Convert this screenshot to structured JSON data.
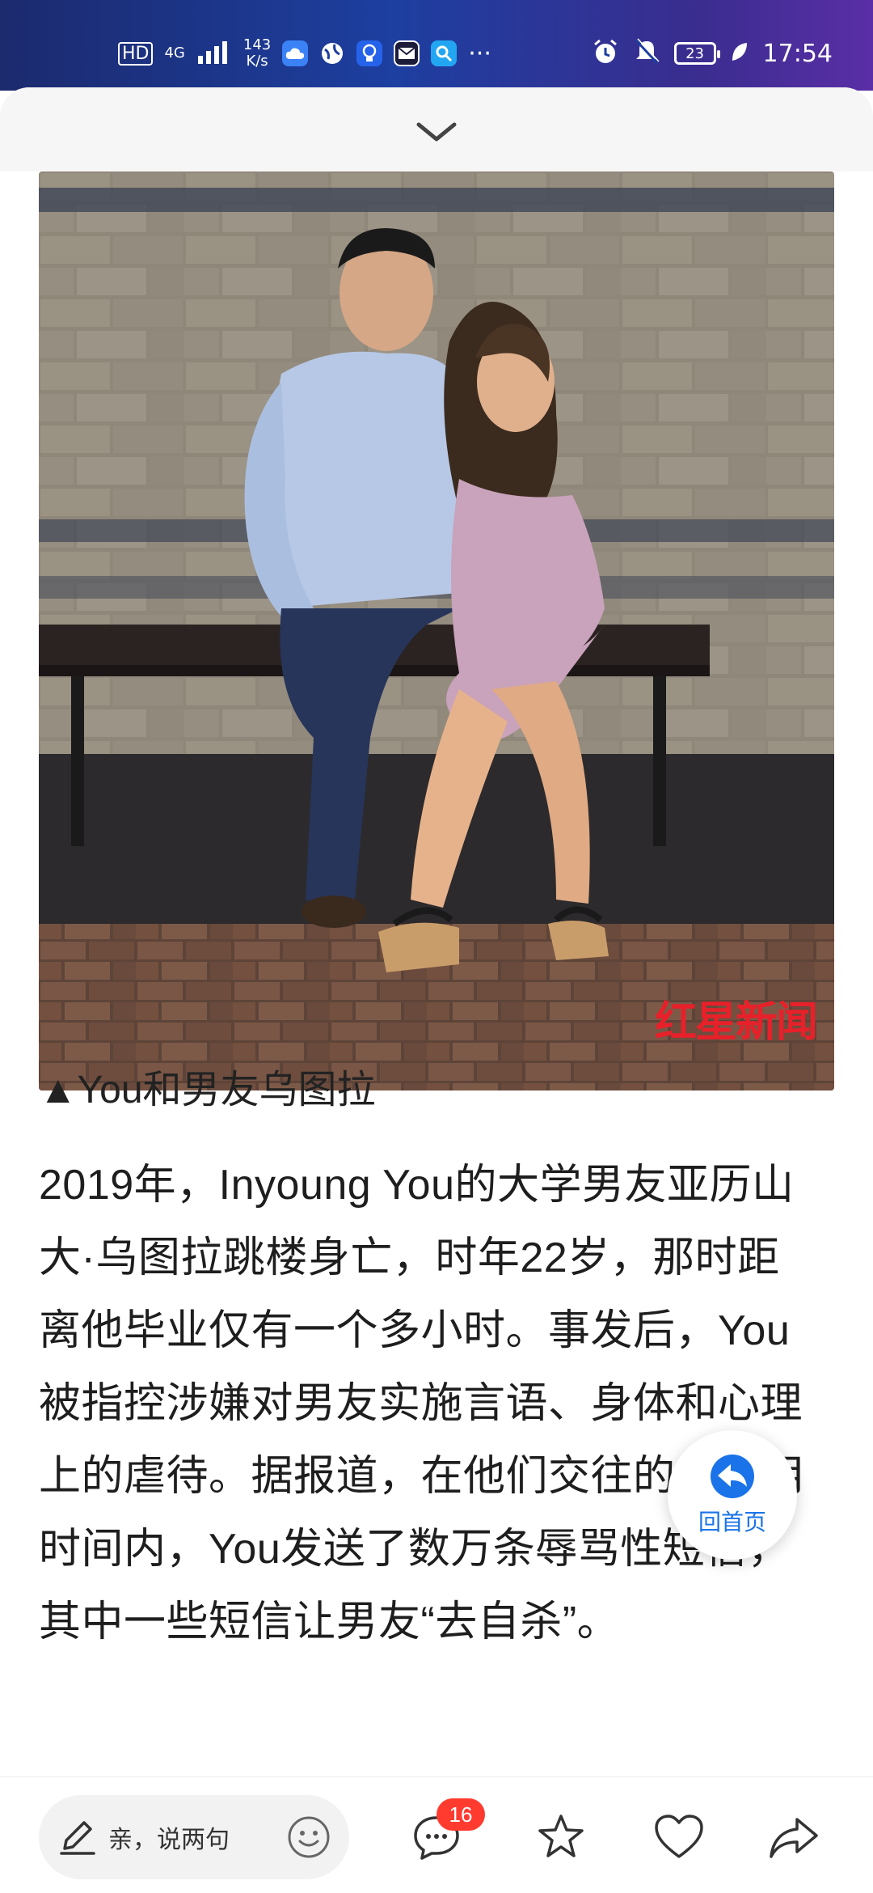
{
  "status_bar": {
    "hd": "HD",
    "network": "4G",
    "speed_top": "143",
    "speed_bottom": "K/s",
    "battery": "23",
    "time": "17:54",
    "more": "···"
  },
  "photo": {
    "watermark": "红星新闻"
  },
  "article": {
    "caption": "▲You和男友乌图拉",
    "lines": [
      "2019年，Inyoung You的大学男友亚历山",
      "大·乌图拉跳楼身亡，时年22岁，那时距",
      "离他毕业仅有一个多小时。事发后，You",
      "被指控涉嫌对男友实施言语、身体和心理",
      "上的虐待。据报道，在他们交往的18个月",
      "时间内，You发送了数万条辱骂性短信，",
      "其中一些短信让男友“去自杀”。"
    ]
  },
  "home_button": {
    "label": "回首页"
  },
  "bottom_bar": {
    "comment_placeholder": "亲，说两句",
    "comment_count": "16"
  },
  "colors": {
    "accent": "#1a73e8",
    "badge": "#ff3b30",
    "watermark": "#e8202a"
  }
}
